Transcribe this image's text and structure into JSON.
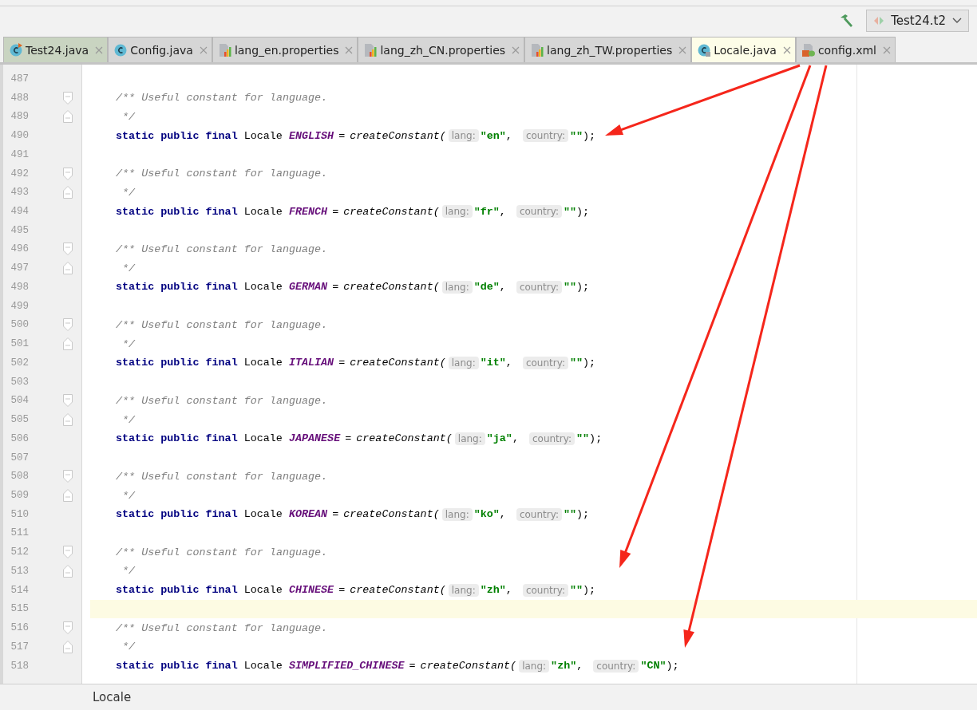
{
  "toolbar": {
    "run_config": "Test24.t2"
  },
  "tabs": [
    {
      "label": "Test24.java",
      "kind": "class-run",
      "selected": false
    },
    {
      "label": "Config.java",
      "kind": "class",
      "selected": false
    },
    {
      "label": "lang_en.properties",
      "kind": "properties",
      "selected": false
    },
    {
      "label": "lang_zh_CN.properties",
      "kind": "properties",
      "selected": false
    },
    {
      "label": "lang_zh_TW.properties",
      "kind": "properties",
      "selected": false
    },
    {
      "label": "Locale.java",
      "kind": "class-locked",
      "selected": true
    },
    {
      "label": "config.xml",
      "kind": "xml",
      "selected": false
    }
  ],
  "lines": [
    {
      "number": "487",
      "kind": "blank",
      "current": false
    },
    {
      "number": "488",
      "kind": "comment-start",
      "text": "/** Useful constant for language.",
      "current": false
    },
    {
      "number": "489",
      "kind": "comment-end",
      "text": " */",
      "current": false
    },
    {
      "number": "490",
      "kind": "decl",
      "modifiers": "static public final",
      "type": "Locale",
      "name": "ENGLISH",
      "op": "=",
      "call": "createConstant(",
      "args": [
        {
          "hint": "lang:",
          "value": "\"en\"",
          "sep": ","
        },
        {
          "hint": "country:",
          "value": "\"\""
        }
      ],
      "end": ");",
      "current": false
    },
    {
      "number": "491",
      "kind": "blank",
      "current": false
    },
    {
      "number": "492",
      "kind": "comment-start",
      "text": "/** Useful constant for language.",
      "current": false
    },
    {
      "number": "493",
      "kind": "comment-end",
      "text": " */",
      "current": false
    },
    {
      "number": "494",
      "kind": "decl",
      "modifiers": "static public final",
      "type": "Locale",
      "name": "FRENCH",
      "op": "=",
      "call": "createConstant(",
      "args": [
        {
          "hint": "lang:",
          "value": "\"fr\"",
          "sep": ","
        },
        {
          "hint": "country:",
          "value": "\"\""
        }
      ],
      "end": ");",
      "current": false
    },
    {
      "number": "495",
      "kind": "blank",
      "current": false
    },
    {
      "number": "496",
      "kind": "comment-start",
      "text": "/** Useful constant for language.",
      "current": false
    },
    {
      "number": "497",
      "kind": "comment-end",
      "text": " */",
      "current": false
    },
    {
      "number": "498",
      "kind": "decl",
      "modifiers": "static public final",
      "type": "Locale",
      "name": "GERMAN",
      "op": "=",
      "call": "createConstant(",
      "args": [
        {
          "hint": "lang:",
          "value": "\"de\"",
          "sep": ","
        },
        {
          "hint": "country:",
          "value": "\"\""
        }
      ],
      "end": ");",
      "current": false
    },
    {
      "number": "499",
      "kind": "blank",
      "current": false
    },
    {
      "number": "500",
      "kind": "comment-start",
      "text": "/** Useful constant for language.",
      "current": false
    },
    {
      "number": "501",
      "kind": "comment-end",
      "text": " */",
      "current": false
    },
    {
      "number": "502",
      "kind": "decl",
      "modifiers": "static public final",
      "type": "Locale",
      "name": "ITALIAN",
      "op": "=",
      "call": "createConstant(",
      "args": [
        {
          "hint": "lang:",
          "value": "\"it\"",
          "sep": ","
        },
        {
          "hint": "country:",
          "value": "\"\""
        }
      ],
      "end": ");",
      "current": false
    },
    {
      "number": "503",
      "kind": "blank",
      "current": false
    },
    {
      "number": "504",
      "kind": "comment-start",
      "text": "/** Useful constant for language.",
      "current": false
    },
    {
      "number": "505",
      "kind": "comment-end",
      "text": " */",
      "current": false
    },
    {
      "number": "506",
      "kind": "decl",
      "modifiers": "static public final",
      "type": "Locale",
      "name": "JAPANESE",
      "op": "=",
      "call": "createConstant(",
      "args": [
        {
          "hint": "lang:",
          "value": "\"ja\"",
          "sep": ","
        },
        {
          "hint": "country:",
          "value": "\"\""
        }
      ],
      "end": ");",
      "current": false
    },
    {
      "number": "507",
      "kind": "blank",
      "current": false
    },
    {
      "number": "508",
      "kind": "comment-start",
      "text": "/** Useful constant for language.",
      "current": false
    },
    {
      "number": "509",
      "kind": "comment-end",
      "text": " */",
      "current": false
    },
    {
      "number": "510",
      "kind": "decl",
      "modifiers": "static public final",
      "type": "Locale",
      "name": "KOREAN",
      "op": "=",
      "call": "createConstant(",
      "args": [
        {
          "hint": "lang:",
          "value": "\"ko\"",
          "sep": ","
        },
        {
          "hint": "country:",
          "value": "\"\""
        }
      ],
      "end": ");",
      "current": false
    },
    {
      "number": "511",
      "kind": "blank",
      "current": false
    },
    {
      "number": "512",
      "kind": "comment-start",
      "text": "/** Useful constant for language.",
      "current": false
    },
    {
      "number": "513",
      "kind": "comment-end",
      "text": " */",
      "current": false
    },
    {
      "number": "514",
      "kind": "decl",
      "modifiers": "static public final",
      "type": "Locale",
      "name": "CHINESE",
      "op": "=",
      "call": "createConstant(",
      "args": [
        {
          "hint": "lang:",
          "value": "\"zh\"",
          "sep": ","
        },
        {
          "hint": "country:",
          "value": "\"\""
        }
      ],
      "end": ");",
      "current": false
    },
    {
      "number": "515",
      "kind": "blank",
      "current": true
    },
    {
      "number": "516",
      "kind": "comment-start",
      "text": "/** Useful constant for language.",
      "current": false
    },
    {
      "number": "517",
      "kind": "comment-end",
      "text": " */",
      "current": false
    },
    {
      "number": "518",
      "kind": "decl",
      "modifiers": "static public final",
      "type": "Locale",
      "name": "SIMPLIFIED_CHINESE",
      "op": "=",
      "call": "createConstant(",
      "args": [
        {
          "hint": "lang:",
          "value": "\"zh\"",
          "sep": ","
        },
        {
          "hint": "country:",
          "value": "\"CN\""
        }
      ],
      "end": ");",
      "current": false
    }
  ],
  "status_bar": {
    "breadcrumb": "Locale"
  }
}
